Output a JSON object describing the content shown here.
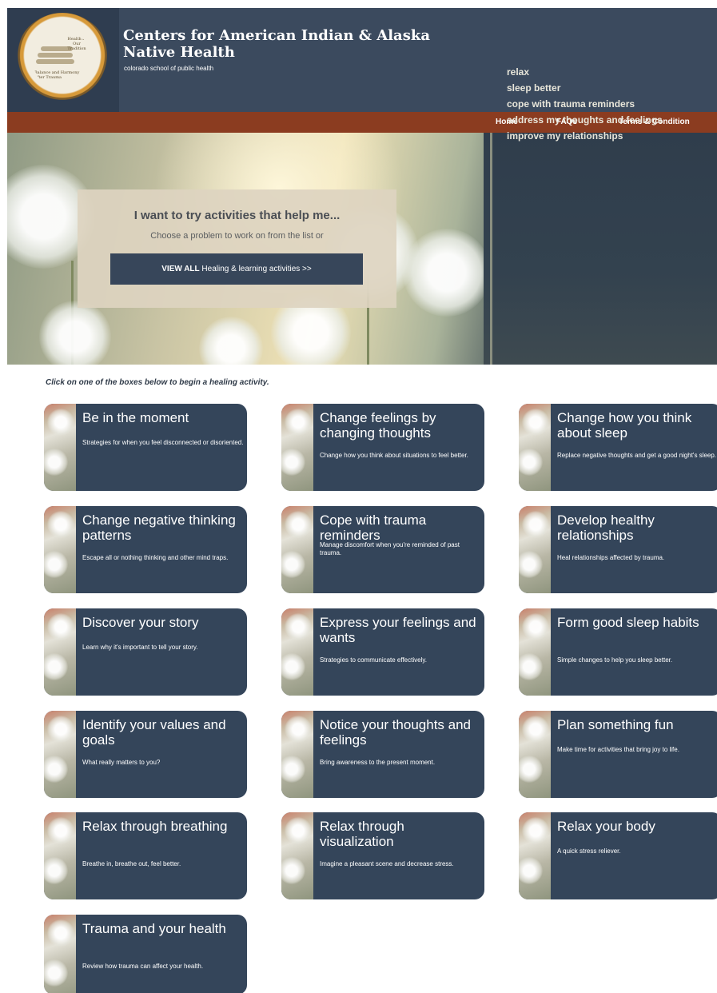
{
  "header": {
    "logo_text_top": "Health is Our Tradition",
    "logo_text_bottom": "Balance and Harmony After Trauma",
    "title": "Centers for American Indian & Alaska Native Health",
    "subtitle": "colorado school of public health"
  },
  "nav": {
    "items": [
      "Home",
      "FAQs",
      "Terms & Condition"
    ]
  },
  "hero": {
    "prompt_title": "I want to try activities that help me...",
    "prompt_sub": "Choose a problem to work on from the list or",
    "view_all_bold": "VIEW ALL",
    "view_all_rest": " Healing & learning activities >>",
    "topics": [
      "relax",
      "sleep better",
      "cope with trauma reminders",
      "address my thoughts and feelings",
      "improve my relationships"
    ]
  },
  "instruction": "Click on one of the boxes below to begin a healing activity.",
  "cards": [
    {
      "title": "Be in the moment",
      "desc": "Strategies for when you feel disconnected or disoriented."
    },
    {
      "title": "Change feelings by changing thoughts",
      "desc": "Change how you think about situations to feel better."
    },
    {
      "title": "Change how you think about sleep",
      "desc": "Replace negative thoughts and get a good night's sleep."
    },
    {
      "title": "Change negative thinking patterns",
      "desc": "Escape all or nothing thinking and other mind traps."
    },
    {
      "title": "Cope with trauma reminders",
      "desc": "Manage discomfort when you're reminded of past trauma."
    },
    {
      "title": "Develop healthy relationships",
      "desc": "Heal relationships affected by trauma."
    },
    {
      "title": "Discover your story",
      "desc": "Learn why it's important to tell your story."
    },
    {
      "title": "Express your feelings and wants",
      "desc": "Strategies to communicate effectively."
    },
    {
      "title": "Form good sleep habits",
      "desc": "Simple changes to help you sleep better."
    },
    {
      "title": "Identify your values and goals",
      "desc": "What really matters to you?"
    },
    {
      "title": "Notice your thoughts and feelings",
      "desc": "Bring awareness to the present moment."
    },
    {
      "title": "Plan something fun",
      "desc": "Make time for activities that bring joy to life."
    },
    {
      "title": "Relax through breathing",
      "desc": "Breathe in, breathe out, feel better."
    },
    {
      "title": "Relax through visualization",
      "desc": "Imagine a pleasant scene and decrease stress."
    },
    {
      "title": "Relax your body",
      "desc": "A quick stress reliever."
    },
    {
      "title": "Trauma and your health",
      "desc": "Review how trauma can affect your health."
    }
  ]
}
